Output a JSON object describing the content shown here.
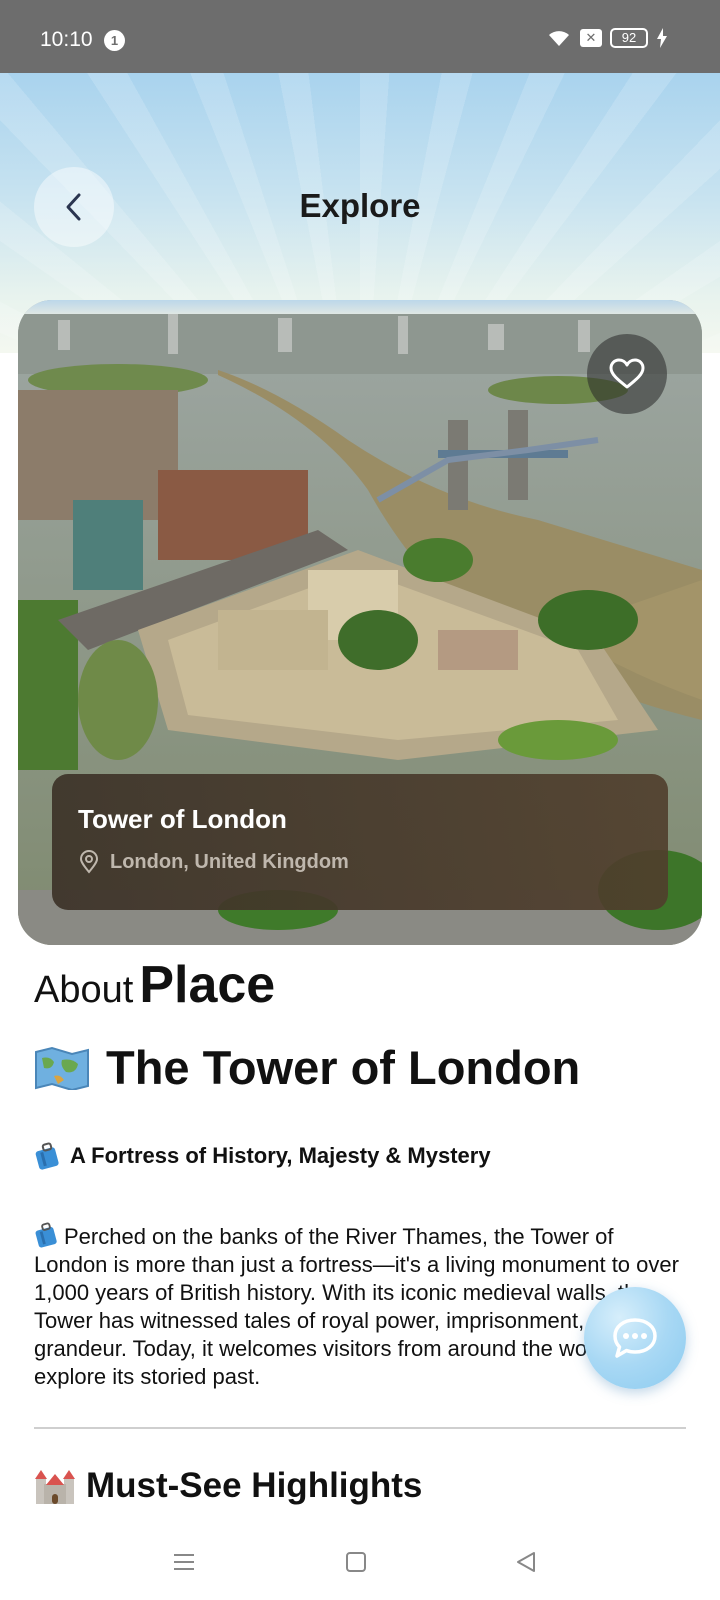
{
  "status_bar": {
    "time": "10:10",
    "notification_count": "1",
    "battery": "92"
  },
  "header": {
    "title": "Explore"
  },
  "place": {
    "name": "Tower of London",
    "location": "London, United Kingdom"
  },
  "about": {
    "light": "About",
    "bold": "Place"
  },
  "article": {
    "title": "The Tower of London",
    "subtitle": "A Fortress of History, Majesty & Mystery",
    "paragraph": "Perched on the banks of the River Thames, the Tower of London is more than just a fortress—it's a living monument to over 1,000 years of British history. With its iconic medieval walls, the Tower has witnessed tales of royal power, imprisonment, and grandeur. Today, it welcomes visitors from around the world to explore its storied past.",
    "highlights_title": "Must-See Highlights"
  },
  "icons": {
    "back": "chevron-left-icon",
    "favorite": "heart-icon",
    "location": "map-pin-icon",
    "title": "world-map-icon",
    "subtitle": "luggage-icon",
    "highlights": "castle-icon",
    "chat": "chat-bubble-icon"
  },
  "colors": {
    "status_bar": "#6d6d6d",
    "sky_top": "#a9d3ee",
    "card_overlay": "#3c3228",
    "fab": "#a8d8f4",
    "text": "#111111"
  }
}
